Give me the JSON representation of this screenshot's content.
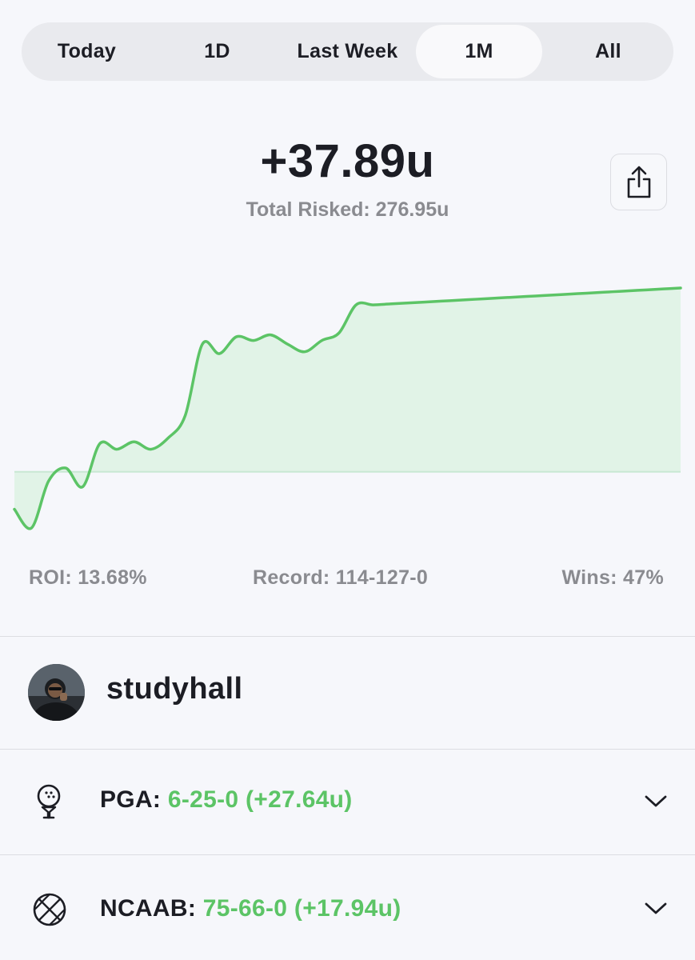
{
  "period_tabs": [
    {
      "label": "Today",
      "active": false
    },
    {
      "label": "1D",
      "active": false
    },
    {
      "label": "Last Week",
      "active": false
    },
    {
      "label": "1M",
      "active": true
    },
    {
      "label": "All",
      "active": false
    }
  ],
  "summary": {
    "profit": "+37.89u",
    "total_risked": "Total Risked: 276.95u"
  },
  "share_button": {
    "icon": "share-icon"
  },
  "stats": {
    "roi": "ROI: 13.68%",
    "record": "Record: 114-127-0",
    "wins": "Wins: 47%"
  },
  "user": {
    "name": "studyhall",
    "avatar_icon": "user-avatar"
  },
  "sports": [
    {
      "league": "PGA:",
      "result": "6-25-0 (+27.64u)",
      "icon": "golf-ball-icon"
    },
    {
      "league": "NCAAB:",
      "result": "75-66-0 (+17.94u)",
      "icon": "basketball-icon"
    }
  ],
  "colors": {
    "accent_green": "#5cc466",
    "fill_green": "#e1f3e7",
    "text_dark": "#1c1d24",
    "text_muted": "#8a8b90"
  },
  "chart_data": {
    "type": "area",
    "x": [
      0,
      1,
      2,
      3,
      4,
      5,
      6,
      7,
      8,
      9,
      10,
      11,
      12,
      13,
      14,
      15,
      16,
      17,
      18,
      19,
      20,
      21,
      22,
      23,
      24,
      25,
      26,
      27,
      28,
      29,
      30,
      31,
      32,
      33,
      34,
      35,
      36,
      37,
      38,
      39
    ],
    "values": [
      -2.0,
      -3.0,
      -0.5,
      0.2,
      -0.8,
      1.5,
      1.2,
      1.6,
      1.2,
      1.8,
      3.0,
      6.8,
      6.3,
      7.2,
      7.0,
      7.3,
      6.8,
      6.4,
      7.0,
      7.4,
      8.9,
      8.9,
      8.95,
      9.0,
      9.05,
      9.1,
      9.15,
      9.2,
      9.25,
      9.3,
      9.35,
      9.4,
      9.45,
      9.5,
      9.55,
      9.6,
      9.65,
      9.7,
      9.75,
      9.8
    ],
    "baseline": 0,
    "grid": false
  }
}
